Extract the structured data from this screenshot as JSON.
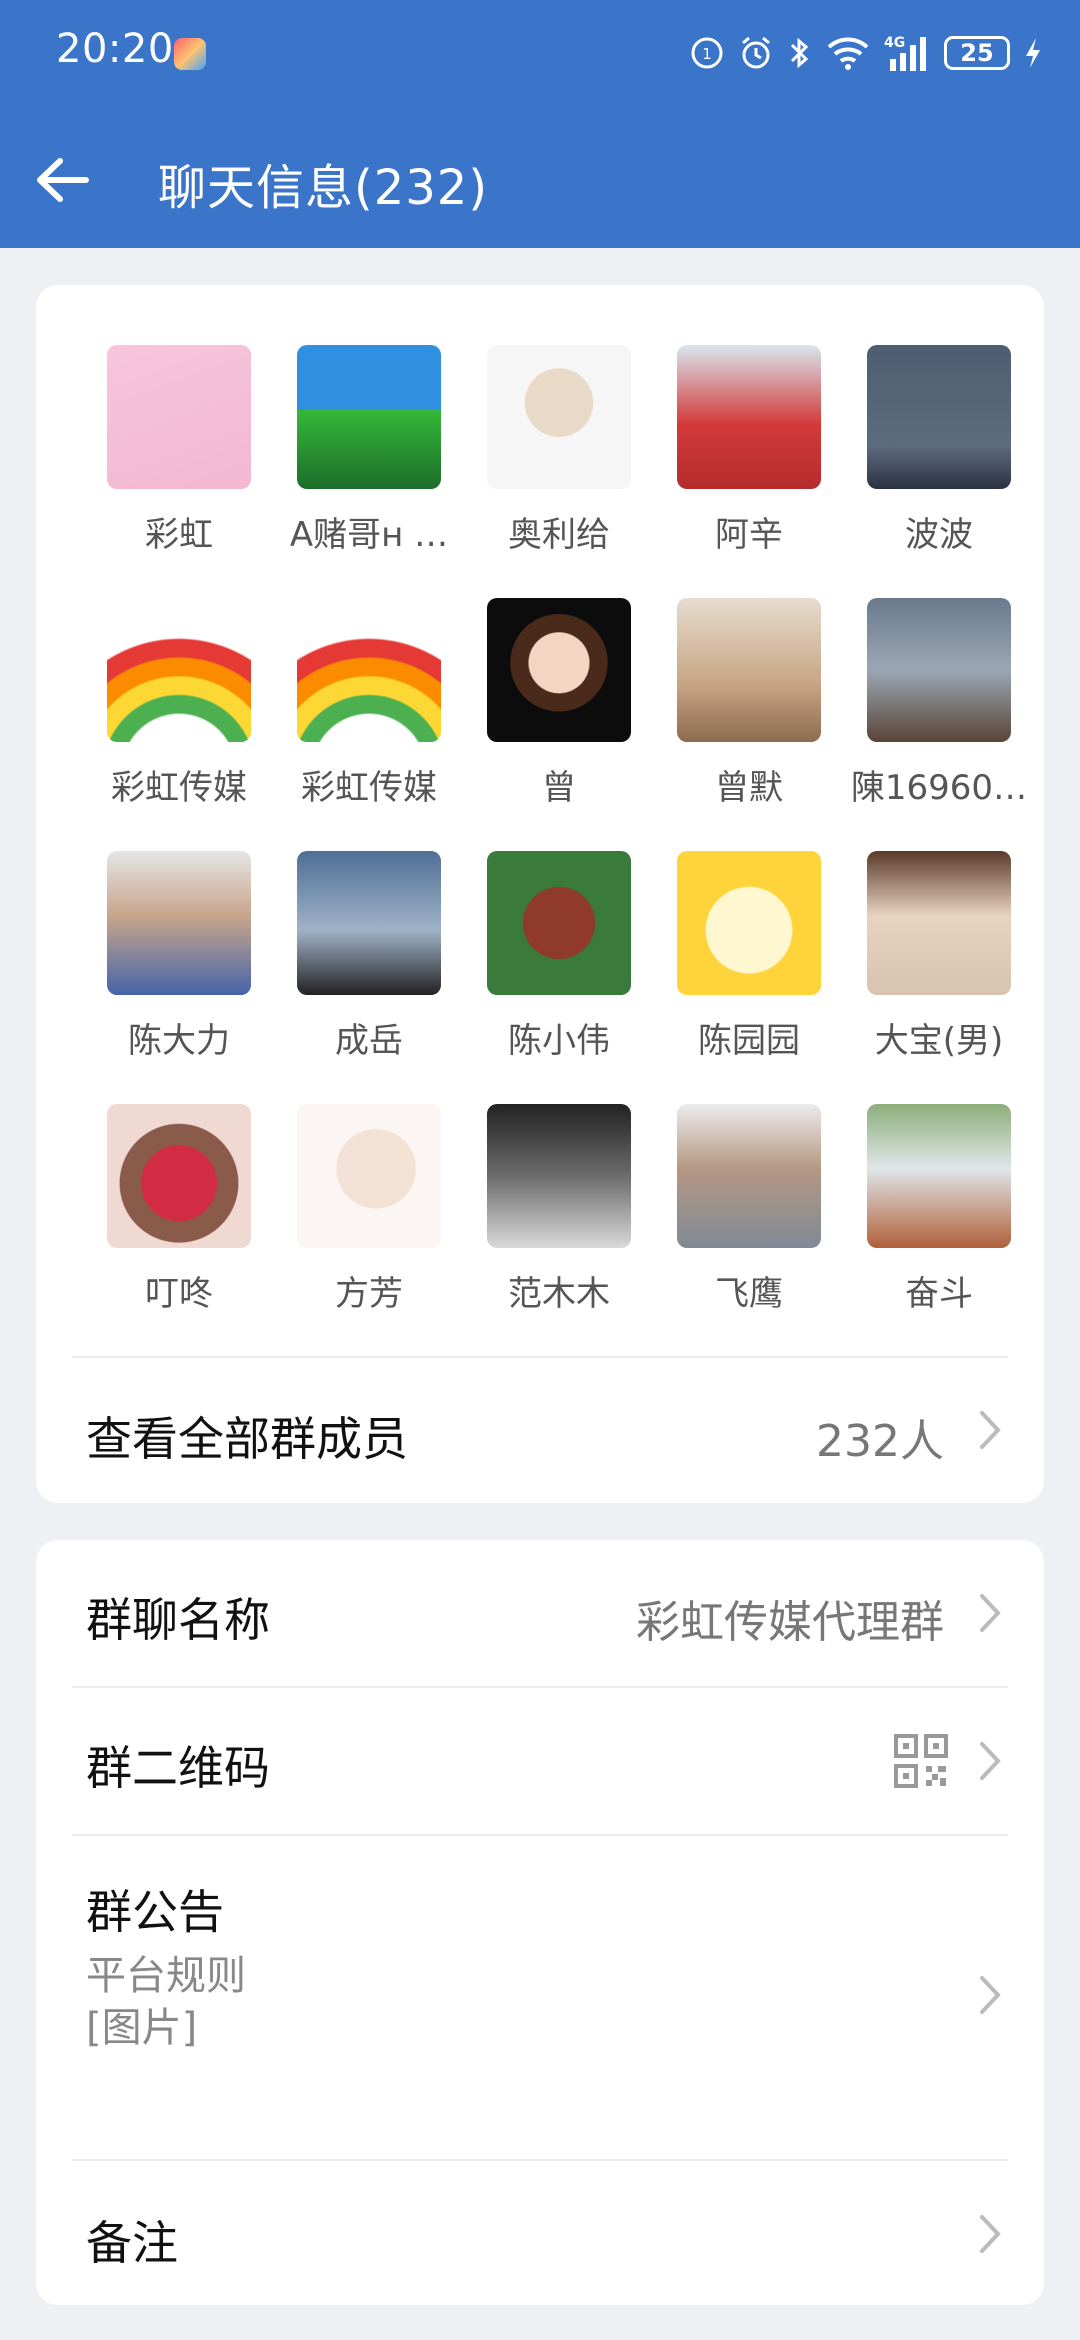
{
  "status": {
    "time": "20:20",
    "battery": "25",
    "network": "4G"
  },
  "header": {
    "title": "聊天信息(232)"
  },
  "members": [
    {
      "name": "彩虹"
    },
    {
      "name": "A赌哥н …"
    },
    {
      "name": "奥利给"
    },
    {
      "name": "阿辛"
    },
    {
      "name": "波波"
    },
    {
      "name": "彩虹传媒"
    },
    {
      "name": "彩虹传媒"
    },
    {
      "name": "曾"
    },
    {
      "name": "曾默"
    },
    {
      "name": "陳16960…"
    },
    {
      "name": "陈大力"
    },
    {
      "name": "成岳"
    },
    {
      "name": "陈小伟"
    },
    {
      "name": "陈园园"
    },
    {
      "name": "大宝(男)"
    },
    {
      "name": "叮咚"
    },
    {
      "name": "方芳"
    },
    {
      "name": "范木木"
    },
    {
      "name": "飞鹰"
    },
    {
      "name": "奋斗"
    }
  ],
  "view_all": {
    "label": "查看全部群成员",
    "count": "232人"
  },
  "settings": {
    "group_name_label": "群聊名称",
    "group_name_value": "彩虹传媒代理群",
    "qr_label": "群二维码",
    "notice_label": "群公告",
    "notice_line1": "平台规则",
    "notice_line2": "[图片]",
    "remark_label": "备注"
  },
  "colors": {
    "header_bg": "#3a75c9",
    "page_bg": "#eff0f4"
  },
  "icons": {
    "back": "arrow-left-icon",
    "chevron": "chevron-right-icon",
    "qr": "qr-code-icon"
  }
}
